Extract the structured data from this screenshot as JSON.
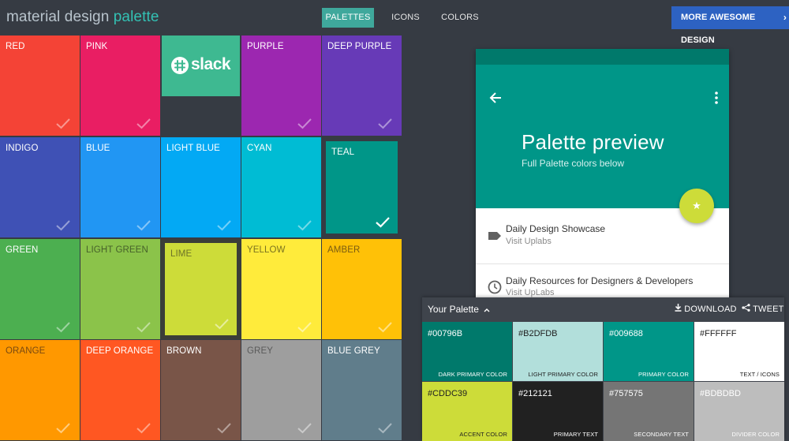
{
  "header": {
    "logo": {
      "part1": "material",
      "part2": "design",
      "part3": "palette"
    },
    "nav": [
      {
        "label": "PALETTES",
        "active": true
      },
      {
        "label": "ICONS",
        "active": false
      },
      {
        "label": "COLORS",
        "active": false
      }
    ],
    "more_button": "MORE AWESOME DESIGN",
    "more_chevron": "›"
  },
  "tiles": [
    {
      "name": "RED",
      "color": "#f44336"
    },
    {
      "name": "PINK",
      "color": "#e91e63"
    },
    {
      "name": "slack",
      "color": "#3eb991",
      "ad": true
    },
    {
      "name": "PURPLE",
      "color": "#9c27b0"
    },
    {
      "name": "DEEP PURPLE",
      "color": "#673ab7"
    },
    {
      "name": "INDIGO",
      "color": "#3f51b5"
    },
    {
      "name": "BLUE",
      "color": "#2196f3"
    },
    {
      "name": "LIGHT BLUE",
      "color": "#03a9f4"
    },
    {
      "name": "CYAN",
      "color": "#00bcd4"
    },
    {
      "name": "TEAL",
      "color": "#009688",
      "selected": true
    },
    {
      "name": "GREEN",
      "color": "#4caf50"
    },
    {
      "name": "LIGHT GREEN",
      "color": "#8bc34a"
    },
    {
      "name": "LIME",
      "color": "#cddc39",
      "selected": true
    },
    {
      "name": "YELLOW",
      "color": "#ffeb3b"
    },
    {
      "name": "AMBER",
      "color": "#ffc107"
    },
    {
      "name": "ORANGE",
      "color": "#ff9800"
    },
    {
      "name": "DEEP ORANGE",
      "color": "#ff5722"
    },
    {
      "name": "BROWN",
      "color": "#795548"
    },
    {
      "name": "GREY",
      "color": "#9e9e9e"
    },
    {
      "name": "BLUE GREY",
      "color": "#607d8b"
    }
  ],
  "preview": {
    "title": "Palette preview",
    "subtitle": "Full Palette colors below",
    "back_icon": "arrow-left-icon",
    "fab_icon": "star-icon",
    "items": [
      {
        "title": "Daily Design Showcase",
        "sub": "Visit Uplabs",
        "icon": "label-icon"
      },
      {
        "title": "Daily Resources for Designers & Developers",
        "sub": "Visit UpLabs",
        "icon": "clock-icon"
      }
    ]
  },
  "your_palette": {
    "title": "Your Palette",
    "download": "DOWNLOAD",
    "tweet": "TWEET",
    "swatches": [
      {
        "hex": "#00796B",
        "role": "DARK PRIMARY COLOR",
        "bg": "#00796b",
        "fg": "#ffffff"
      },
      {
        "hex": "#B2DFDB",
        "role": "LIGHT PRIMARY COLOR",
        "bg": "#b2dfdb",
        "fg": "#212121"
      },
      {
        "hex": "#009688",
        "role": "PRIMARY COLOR",
        "bg": "#009688",
        "fg": "#ffffff"
      },
      {
        "hex": "#FFFFFF",
        "role": "TEXT / ICONS",
        "bg": "#ffffff",
        "fg": "#212121"
      },
      {
        "hex": "#CDDC39",
        "role": "ACCENT COLOR",
        "bg": "#cddc39",
        "fg": "#212121"
      },
      {
        "hex": "#212121",
        "role": "PRIMARY TEXT",
        "bg": "#212121",
        "fg": "#ffffff"
      },
      {
        "hex": "#757575",
        "role": "SECONDARY TEXT",
        "bg": "#757575",
        "fg": "#ffffff"
      },
      {
        "hex": "#BDBDBD",
        "role": "DIVIDER COLOR",
        "bg": "#bdbdbd",
        "fg": "#ffffff"
      }
    ]
  }
}
